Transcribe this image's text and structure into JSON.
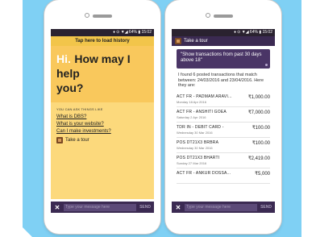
{
  "left_phone": {
    "status_text": "♦ ⊙ ▼◢ 64% ▮ 15:02",
    "history_bar": "Tap here to load history",
    "greeting_hi": "Hi.",
    "greeting_rest": "How may I help",
    "greeting_you": "you?",
    "suggestions_title": "YOU CAN ASK THINGS LIKE",
    "suggestions": [
      "What is DBS?",
      "What is your website?",
      "Can I make investments?"
    ],
    "tour_label": "Take a tour",
    "input_placeholder": "Type your message here",
    "send_label": "SEND"
  },
  "right_phone": {
    "status_text": "♦ ⊙ ▼◢ 64% ▮ 15:02",
    "tour_label": "Take a tour",
    "query": "\"Show transactions from past 30 days above 18\"",
    "answer": "I found 6 posted transactions that match between: 24/03/2016 and 23/04/2016. Here they are:",
    "transactions": [
      {
        "name": "ACT FR - PADMAM ARAVI...",
        "date": "Monday 18 Apr 2016",
        "amount": "₹1,000.00"
      },
      {
        "name": "ACT FR - ANSHITI GOEA",
        "date": "Saturday 2 Apr 2016",
        "amount": "₹7,000.00"
      },
      {
        "name": "TDR IN - DEBIT CARD -",
        "date": "Wednesday 30 Mar 2016",
        "amount": "₹100.00"
      },
      {
        "name": "POS DT21X3 BRBRA",
        "date": "Wednesday 30 Mar 2016",
        "amount": "₹100.00"
      },
      {
        "name": "POS DT21X3 BHARTI",
        "date": "Sunday 27 Mar 2016",
        "amount": "₹2,419.00"
      },
      {
        "name": "ACT FR - ANKUR DOSSA...",
        "date": "",
        "amount": "₹5,000"
      }
    ],
    "input_placeholder": "Type your message here",
    "send_label": "SEND"
  }
}
